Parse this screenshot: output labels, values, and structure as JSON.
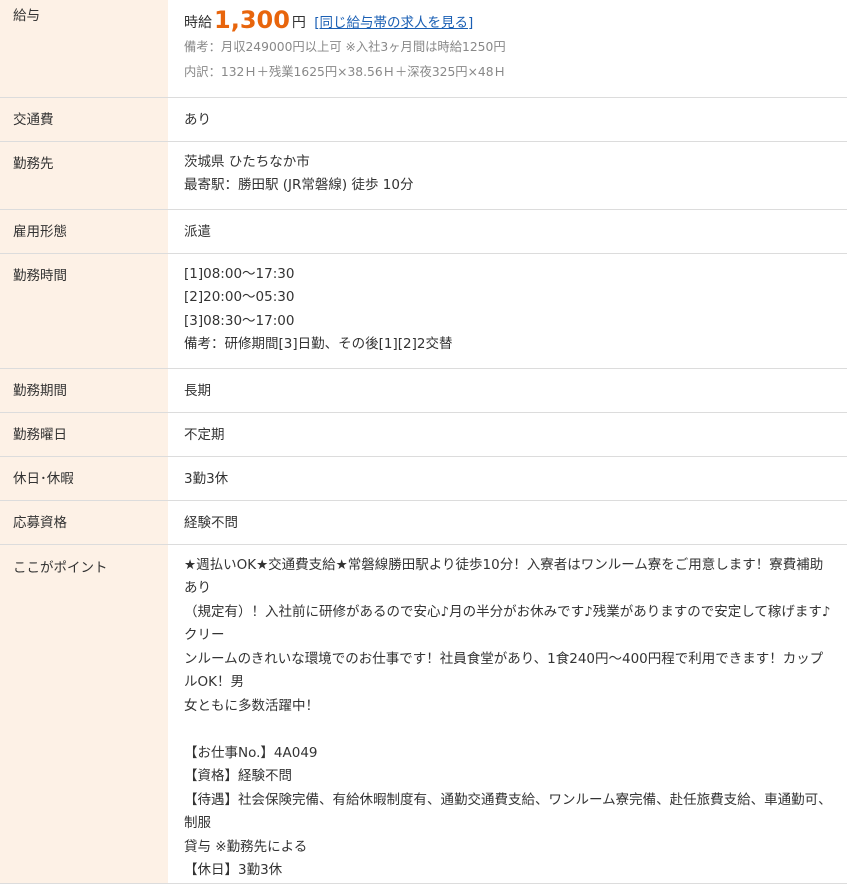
{
  "salary": {
    "label": "給与",
    "prefix": "時給",
    "amount": "1,300",
    "unit": "円",
    "link": "[同じ給与帯の求人を見る]",
    "note1": "備考：月収249000円以上可 ※入社3ヶ月間は時給1250円",
    "note2": "内訳：132Ｈ＋残業1625円×38.56Ｈ＋深夜325円×48Ｈ"
  },
  "transport": {
    "label": "交通費",
    "value": "あり"
  },
  "workplace": {
    "label": "勤務先",
    "line1": "茨城県 ひたちなか市",
    "line2": "最寄駅：勝田駅 (JR常磐線) 徒歩 10分"
  },
  "employment": {
    "label": "雇用形態",
    "value": "派遣"
  },
  "hours": {
    "label": "勤務時間",
    "lines": [
      "[1]08:00～17:30",
      "[2]20:00～05:30",
      "[3]08:30～17:00",
      "備考：研修期間[3]日勤、その後[1][2]2交替"
    ]
  },
  "period": {
    "label": "勤務期間",
    "value": "長期"
  },
  "days": {
    "label": "勤務曜日",
    "value": "不定期"
  },
  "holiday": {
    "label": "休日･休暇",
    "value": "3勤3休"
  },
  "qualification": {
    "label": "応募資格",
    "value": "経験不問"
  },
  "point": {
    "label": "ここがポイント",
    "lines": [
      "★週払いOK★交通費支給★常磐線勝田駅より徒歩10分！入寮者はワンルーム寮をご用意します！寮費補助あり",
      "（規定有）！入社前に研修があるので安心♪月の半分がお休みです♪残業がありますので安定して稼げます♪クリー",
      "ンルームのきれいな環境でのお仕事です！社員食堂があり、1食240円～400円程で利用できます！カップルOK！男",
      "女ともに多数活躍中！"
    ],
    "lines2": [
      "【お仕事No.】4A049",
      "【資格】経験不問",
      "【待遇】社会保険完備、有給休暇制度有、通勤交通費支給、ワンルーム寮完備、赴任旅費支給、車通勤可、制服",
      "貸与 ※勤務先による",
      "【休日】3勤3休"
    ]
  }
}
